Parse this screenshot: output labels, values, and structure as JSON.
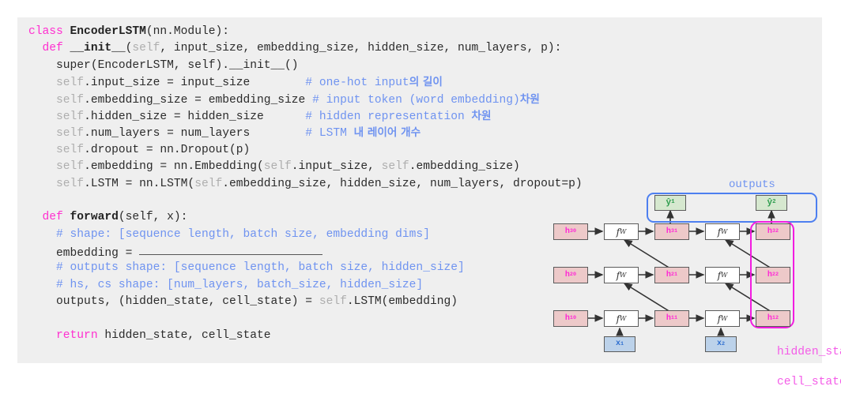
{
  "code": {
    "lines": [
      [
        {
          "t": "class ",
          "c": "kw"
        },
        {
          "t": "EncoderLSTM",
          "c": "clsname"
        },
        {
          "t": "(nn.Module):",
          "c": "plain"
        }
      ],
      [
        {
          "t": "  ",
          "c": "plain"
        },
        {
          "t": "def ",
          "c": "kw"
        },
        {
          "t": "__init__",
          "c": "fnname"
        },
        {
          "t": "(",
          "c": "plain"
        },
        {
          "t": "self",
          "c": "selfclr"
        },
        {
          "t": ", input_size, embedding_size, hidden_size, num_layers, p):",
          "c": "plain"
        }
      ],
      [
        {
          "t": "    super(EncoderLSTM, self).__init__()",
          "c": "plain"
        }
      ],
      [
        {
          "t": "    ",
          "c": "plain"
        },
        {
          "t": "self",
          "c": "selfclr"
        },
        {
          "t": ".input_size = input_size",
          "c": "plain"
        },
        {
          "t": "        # one-hot input",
          "c": "cmt"
        },
        {
          "t": "의 길이",
          "c": "cmt-ko"
        }
      ],
      [
        {
          "t": "    ",
          "c": "plain"
        },
        {
          "t": "self",
          "c": "selfclr"
        },
        {
          "t": ".embedding_size = embedding_size",
          "c": "plain"
        },
        {
          "t": " # input token (word embedding)",
          "c": "cmt"
        },
        {
          "t": "차원",
          "c": "cmt-ko"
        }
      ],
      [
        {
          "t": "    ",
          "c": "plain"
        },
        {
          "t": "self",
          "c": "selfclr"
        },
        {
          "t": ".hidden_size = hidden_size",
          "c": "plain"
        },
        {
          "t": "      # hidden representation ",
          "c": "cmt"
        },
        {
          "t": "차원",
          "c": "cmt-ko"
        }
      ],
      [
        {
          "t": "    ",
          "c": "plain"
        },
        {
          "t": "self",
          "c": "selfclr"
        },
        {
          "t": ".num_layers = num_layers",
          "c": "plain"
        },
        {
          "t": "        # LSTM ",
          "c": "cmt"
        },
        {
          "t": "내 레이어 개수",
          "c": "cmt-ko"
        }
      ],
      [
        {
          "t": "    ",
          "c": "plain"
        },
        {
          "t": "self",
          "c": "selfclr"
        },
        {
          "t": ".dropout = nn.Dropout(p)",
          "c": "plain"
        }
      ],
      [
        {
          "t": "    ",
          "c": "plain"
        },
        {
          "t": "self",
          "c": "selfclr"
        },
        {
          "t": ".embedding = nn.Embedding(",
          "c": "plain"
        },
        {
          "t": "self",
          "c": "selfclr"
        },
        {
          "t": ".input_size, ",
          "c": "plain"
        },
        {
          "t": "self",
          "c": "selfclr"
        },
        {
          "t": ".embedding_size)",
          "c": "plain"
        }
      ],
      [
        {
          "t": "    ",
          "c": "plain"
        },
        {
          "t": "self",
          "c": "selfclr"
        },
        {
          "t": ".LSTM = nn.LSTM(",
          "c": "plain"
        },
        {
          "t": "self",
          "c": "selfclr"
        },
        {
          "t": ".embedding_size, hidden_size, num_layers, dropout=p)",
          "c": "plain"
        }
      ],
      [
        {
          "t": " ",
          "c": "plain"
        }
      ],
      [
        {
          "t": "  ",
          "c": "plain"
        },
        {
          "t": "def ",
          "c": "kw"
        },
        {
          "t": "forward",
          "c": "fnname"
        },
        {
          "t": "(self, x):",
          "c": "plain"
        }
      ],
      [
        {
          "t": "    # shape: [sequence length, batch size, embedding dims]",
          "c": "cmt"
        }
      ],
      [
        {
          "t": "    embedding = ",
          "c": "plain"
        },
        {
          "t": "__BLANK__",
          "c": "blank"
        }
      ],
      [
        {
          "t": "    # outputs shape: [sequence length, batch size, hidden_size]",
          "c": "cmt"
        }
      ],
      [
        {
          "t": "    # hs, cs shape: [num_layers, batch_size, hidden_size]",
          "c": "cmt"
        }
      ],
      [
        {
          "t": "    outputs, (hidden_state, cell_state) = ",
          "c": "plain"
        },
        {
          "t": "self",
          "c": "selfclr"
        },
        {
          "t": ".LSTM(embedding)",
          "c": "plain"
        }
      ],
      [
        {
          "t": " ",
          "c": "plain"
        }
      ],
      [
        {
          "t": "    ",
          "c": "plain"
        },
        {
          "t": "return ",
          "c": "kw"
        },
        {
          "t": "hidden_state, cell_state",
          "c": "plain"
        }
      ]
    ]
  },
  "diagram": {
    "outputs_label": "outputs",
    "hidden_state_label": "hidden_state",
    "cell_state_label": "cell_state",
    "y_nodes": [
      {
        "base": "ŷ",
        "sub": "1"
      },
      {
        "base": "ŷ",
        "sub": "2"
      }
    ],
    "h_nodes": [
      {
        "base": "h",
        "sub": "30"
      },
      {
        "base": "h",
        "sub": "31"
      },
      {
        "base": "h",
        "sub": "32"
      },
      {
        "base": "h",
        "sub": "20"
      },
      {
        "base": "h",
        "sub": "21"
      },
      {
        "base": "h",
        "sub": "22"
      },
      {
        "base": "h",
        "sub": "10"
      },
      {
        "base": "h",
        "sub": "11"
      },
      {
        "base": "h",
        "sub": "12"
      }
    ],
    "fw_nodes": [
      {
        "base": "f",
        "sub": "W"
      },
      {
        "base": "f",
        "sub": "W"
      },
      {
        "base": "f",
        "sub": "W"
      },
      {
        "base": "f",
        "sub": "W"
      },
      {
        "base": "f",
        "sub": "W"
      },
      {
        "base": "f",
        "sub": "W"
      }
    ],
    "x_nodes": [
      {
        "base": "x",
        "sub": "1"
      },
      {
        "base": "x",
        "sub": "2"
      }
    ]
  },
  "colors": {
    "panel_bg": "#efefef",
    "comment": "#6f93f0",
    "keyword": "#ff2fd0",
    "self": "#aeaeae",
    "h_fill": "#edc9c9",
    "h_text": "#ff27d6",
    "y_fill": "#d6e8cf",
    "y_text": "#2f9e4f",
    "x_fill": "#bcd2ea",
    "x_text": "#2f6fd0",
    "outputs_frame": "#4d7ff0",
    "hidden_frame": "#f21ce0"
  }
}
